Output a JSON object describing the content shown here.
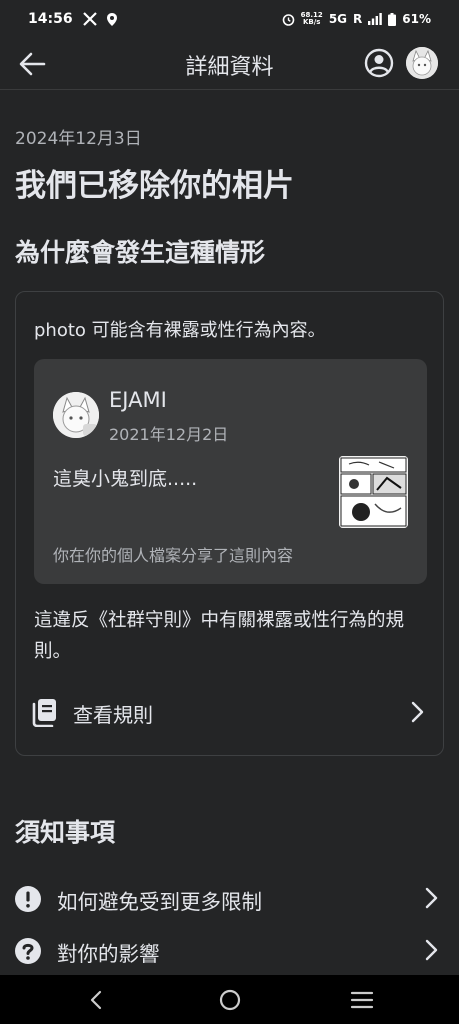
{
  "status": {
    "time": "14:56",
    "net_speed_value": "68.12",
    "net_speed_unit": "KB/s",
    "network": "5G",
    "roaming": "R",
    "battery": "61%",
    "icons": [
      "x-logo-icon",
      "location-icon",
      "alarm-icon",
      "signal-icon",
      "battery-icon"
    ]
  },
  "header": {
    "title": "詳細資料",
    "back_icon": "back-arrow-icon",
    "profile_icon": "account-circle-icon"
  },
  "main": {
    "date": "2024年12月3日",
    "title": "我們已移除你的相片",
    "why_heading": "為什麼會發生這種情形",
    "card": {
      "reason": "photo 可能含有裸露或性行為內容。",
      "post": {
        "author": "EJAMI",
        "date": "2021年12月2日",
        "text": "這臭小鬼到底.....",
        "note": "你在你的個人檔案分享了這則內容"
      },
      "violation": "這違反《社群守則》中有關裸露或性行為的規則。",
      "rules_link": "查看規則"
    },
    "notice_heading": "須知事項",
    "notice_items": [
      {
        "label": "如何避免受到更多限制",
        "icon": "exclamation-circle-icon"
      },
      {
        "label": "對你的影響",
        "icon": "question-circle-icon"
      }
    ]
  },
  "nav": {
    "back": "nav-back-icon",
    "home": "nav-home-icon",
    "recents": "nav-recents-icon"
  },
  "colors": {
    "background": "#242526",
    "card_border": "#3e4042",
    "post_bg": "#3a3b3c",
    "text_primary": "#e4e6eb",
    "text_secondary": "#b0b3b8",
    "nav_bg": "#000000"
  }
}
